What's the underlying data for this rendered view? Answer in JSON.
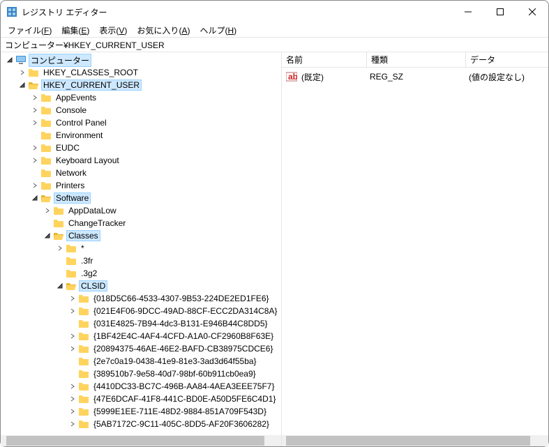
{
  "window": {
    "title": "レジストリ エディター"
  },
  "menu": {
    "file": "ファイル",
    "file_m": "F",
    "edit": "編集",
    "edit_m": "E",
    "view": "表示",
    "view_m": "V",
    "fav": "お気に入り",
    "fav_m": "A",
    "help": "ヘルプ",
    "help_m": "H"
  },
  "address": "コンピューター¥HKEY_CURRENT_USER",
  "tree": {
    "root": "コンピューター",
    "hkcr": "HKEY_CLASSES_ROOT",
    "hkcu": "HKEY_CURRENT_USER",
    "appEvents": "AppEvents",
    "console": "Console",
    "controlPanel": "Control Panel",
    "environment": "Environment",
    "eudc": "EUDC",
    "keyboard": "Keyboard Layout",
    "network": "Network",
    "printers": "Printers",
    "software": "Software",
    "appDataLow": "AppDataLow",
    "changeTracker": "ChangeTracker",
    "classes": "Classes",
    "star": "*",
    "ext3fr": ".3fr",
    "ext3g2": ".3g2",
    "clsid": "CLSID",
    "g0": "{018D5C66-4533-4307-9B53-224DE2ED1FE6}",
    "g1": "{021E4F06-9DCC-49AD-88CF-ECC2DA314C8A}",
    "g2": "{031E4825-7B94-4dc3-B131-E946B44C8DD5}",
    "g3": "{1BF42E4C-4AF4-4CFD-A1A0-CF2960B8F63E}",
    "g4": "{20894375-46AE-46E2-BAFD-CB38975CDCE6}",
    "g5": "{2e7c0a19-0438-41e9-81e3-3ad3d64f55ba}",
    "g6": "{389510b7-9e58-40d7-98bf-60b911cb0ea9}",
    "g7": "{4410DC33-BC7C-496B-AA84-4AEA3EEE75F7}",
    "g8": "{47E6DCAF-41F8-441C-BD0E-A50D5FE6C4D1}",
    "g9": "{5999E1EE-711E-48D2-9884-851A709F543D}",
    "g10": "{5AB7172C-9C11-405C-8DD5-AF20F3606282}"
  },
  "columns": {
    "name": "名前",
    "type": "種類",
    "data": "データ"
  },
  "values": {
    "default_name": "(既定)",
    "default_type": "REG_SZ",
    "default_data": "(値の設定なし)"
  }
}
